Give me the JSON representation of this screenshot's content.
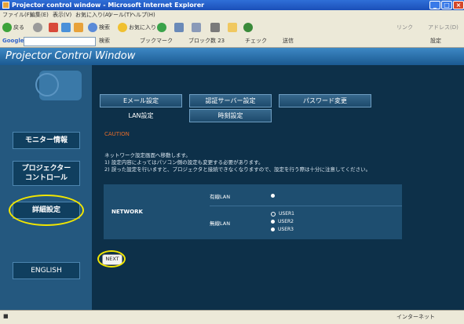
{
  "window": {
    "title": "Projector control window - Microsoft Internet Explorer",
    "minimize": "_",
    "maximize": "□",
    "close": "×"
  },
  "menubar": [
    "ファイル(F)",
    "編集(E)",
    "表示(V)",
    "お気に入り(A)",
    "ツール(T)",
    "ヘルプ(H)"
  ],
  "toolbar": {
    "back": "戻る",
    "search": "検索",
    "favorites": "お気に入り",
    "links": "リンク",
    "address": "アドレス(D)"
  },
  "googlebar": {
    "label": "Google",
    "search_btn": "検索",
    "bookmarks": "ブックマーク",
    "blocked": "ブロック数 23",
    "check": "チェック",
    "send": "送信",
    "settings": "設定"
  },
  "page": {
    "header_title": "Projector Control Window"
  },
  "sidebar": {
    "items": [
      {
        "label": "モニター情報"
      },
      {
        "label": "プロジェクター\nコントロール"
      },
      {
        "label": "詳細設定"
      },
      {
        "label": "ENGLISH"
      }
    ]
  },
  "tabs": {
    "email": "Eメール設定",
    "auth": "認証サーバー設定",
    "password": "パスワード変更",
    "lan": "LAN設定",
    "time": "時刻設定"
  },
  "content": {
    "caution": "CAUTION",
    "line1": "ネットワーク設定画面へ移動します。",
    "line2": "1) 設定内容によってはパソコン側の設定も変更する必要があります。",
    "line3": "2) 誤った設定を行いますと、プロジェクタと接続できなくなりますので、設定を行う際は十分に注意してください。",
    "network_label": "NETWORK",
    "wired_label": "有線LAN",
    "wireless_label": "無線LAN",
    "users": [
      "USER1",
      "USER2",
      "USER3"
    ],
    "next": "NEXT"
  },
  "status": {
    "zone": "インターネット"
  },
  "colors": {
    "highlight": "#f2e600",
    "caution": "#e46b2a"
  }
}
